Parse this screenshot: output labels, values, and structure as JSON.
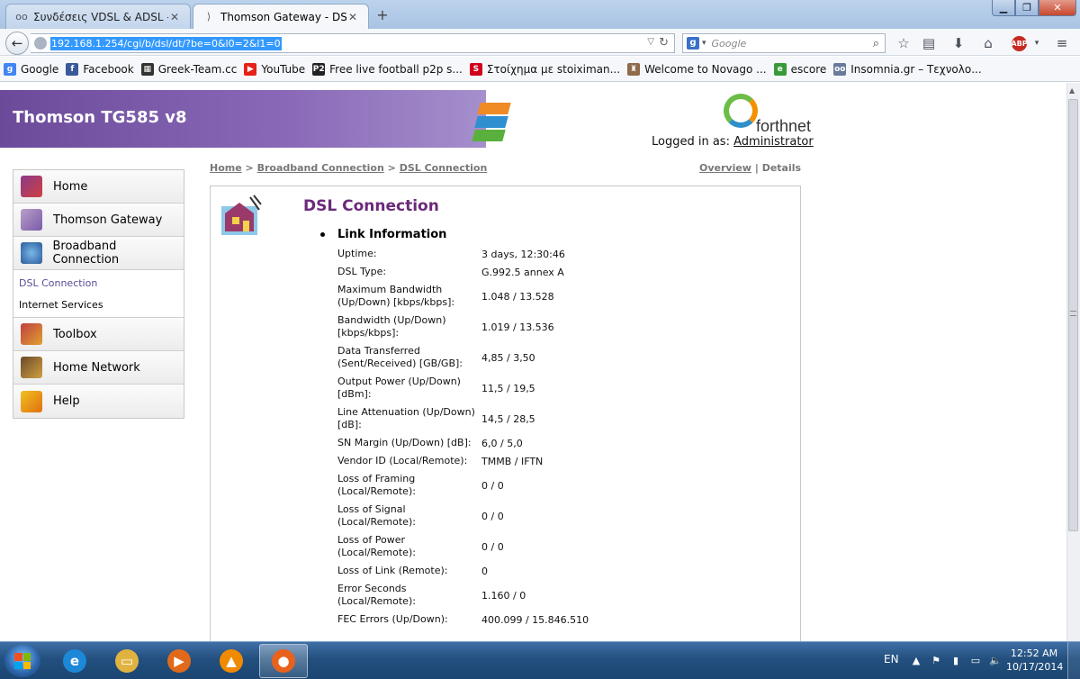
{
  "browser": {
    "tabs": [
      {
        "label": "Συνδέσεις VDSL & ADSL - I...",
        "active": false
      },
      {
        "label": "Thomson Gateway - DSL C...",
        "active": true
      }
    ],
    "url": "192.168.1.254/cgi/b/dsl/dt/?be=0&l0=2&l1=0",
    "search_placeholder": "Google",
    "search_engine_letter": "g",
    "adblock_label": "ABP",
    "bookmarks": [
      {
        "label": "Google",
        "icon": "google-icon",
        "color": "#4285f4",
        "glyph": "g"
      },
      {
        "label": "Facebook",
        "icon": "facebook-icon",
        "color": "#3b5998",
        "glyph": "f"
      },
      {
        "label": "Greek-Team.cc",
        "icon": "film-icon",
        "color": "#333333",
        "glyph": "▦"
      },
      {
        "label": "YouTube",
        "icon": "youtube-icon",
        "color": "#e62117",
        "glyph": "▶"
      },
      {
        "label": "Free live football p2p s...",
        "icon": "p2p-icon",
        "color": "#222222",
        "glyph": "P2"
      },
      {
        "label": "Στοίχημα με stoiximan...",
        "icon": "stoiximan-icon",
        "color": "#d0021b",
        "glyph": "S"
      },
      {
        "label": "Welcome to Novago ...",
        "icon": "novago-icon",
        "color": "#8e6b4a",
        "glyph": "♜"
      },
      {
        "label": "escore",
        "icon": "escore-icon",
        "color": "#3a9a3a",
        "glyph": "e"
      },
      {
        "label": "Insomnia.gr – Τεχνολο...",
        "icon": "insomnia-icon",
        "color": "#6a7a9a",
        "glyph": "oo"
      }
    ]
  },
  "header": {
    "title": "Thomson TG585 v8",
    "logo_text": "forthnet",
    "logged_in_prefix": "Logged in as:",
    "logged_in_user": "Administrator"
  },
  "menu": {
    "items": [
      {
        "label": "Home",
        "icon": "house-icon"
      },
      {
        "label": "Thomson Gateway",
        "icon": "gateway-icon"
      },
      {
        "label": "Broadband Connection",
        "icon": "globe-icon"
      }
    ],
    "subitems": [
      {
        "label": "DSL Connection",
        "selected": true
      },
      {
        "label": "Internet Services",
        "selected": false
      }
    ],
    "items_after": [
      {
        "label": "Toolbox",
        "icon": "toolbox-icon"
      },
      {
        "label": "Home Network",
        "icon": "home-network-icon"
      },
      {
        "label": "Help",
        "icon": "help-icon"
      }
    ]
  },
  "breadcrumb": {
    "home": "Home",
    "sep": ">",
    "section": "Broadband Connection",
    "page": "DSL Connection"
  },
  "views": {
    "overview": "Overview",
    "sep": "|",
    "details": "Details"
  },
  "content": {
    "title": "DSL Connection",
    "section": "Link Information",
    "rows": [
      {
        "label": "Uptime:",
        "value": "3 days, 12:30:46"
      },
      {
        "label": "DSL Type:",
        "value": "G.992.5 annex A"
      },
      {
        "label": "Maximum Bandwidth (Up/Down) [kbps/kbps]:",
        "value": "1.048 / 13.528"
      },
      {
        "label": "Bandwidth (Up/Down) [kbps/kbps]:",
        "value": "1.019 / 13.536"
      },
      {
        "label": "Data Transferred (Sent/Received) [GB/GB]:",
        "value": "4,85 / 3,50"
      },
      {
        "label": "Output Power (Up/Down) [dBm]:",
        "value": "11,5 / 19,5"
      },
      {
        "label": "Line Attenuation (Up/Down) [dB]:",
        "value": "14,5 / 28,5"
      },
      {
        "label": "SN Margin (Up/Down) [dB]:",
        "value": "6,0 / 5,0"
      },
      {
        "label": "Vendor ID (Local/Remote):",
        "value": "TMMB / IFTN"
      },
      {
        "label": "Loss of Framing (Local/Remote):",
        "value": "0 / 0"
      },
      {
        "label": "Loss of Signal (Local/Remote):",
        "value": "0 / 0"
      },
      {
        "label": "Loss of Power (Local/Remote):",
        "value": "0 / 0"
      },
      {
        "label": "Loss of Link (Remote):",
        "value": "0"
      },
      {
        "label": "Error Seconds (Local/Remote):",
        "value": "1.160 / 0"
      },
      {
        "label": "FEC Errors (Up/Down):",
        "value": "400.099 / 15.846.510"
      }
    ]
  },
  "taskbar": {
    "apps": [
      {
        "name": "internet-explorer",
        "icon": "ie-icon",
        "glyph": "e",
        "color": "#1e88d8",
        "active": false
      },
      {
        "name": "file-explorer",
        "icon": "folder-icon",
        "glyph": "▭",
        "color": "#e0b341",
        "active": false
      },
      {
        "name": "media-player",
        "icon": "media-player-icon",
        "glyph": "▶",
        "color": "#e06a1a",
        "active": false
      },
      {
        "name": "vlc",
        "icon": "vlc-icon",
        "glyph": "▲",
        "color": "#f08a00",
        "active": false
      },
      {
        "name": "firefox",
        "icon": "firefox-icon",
        "glyph": "●",
        "color": "#e8621c",
        "active": true
      }
    ],
    "lang": "EN",
    "time": "12:52 AM",
    "date": "10/17/2014"
  },
  "colors": {
    "accent_purple": "#6b2a7a",
    "banner_purple": "#7a5aa8",
    "url_highlight": "#3399ff"
  }
}
